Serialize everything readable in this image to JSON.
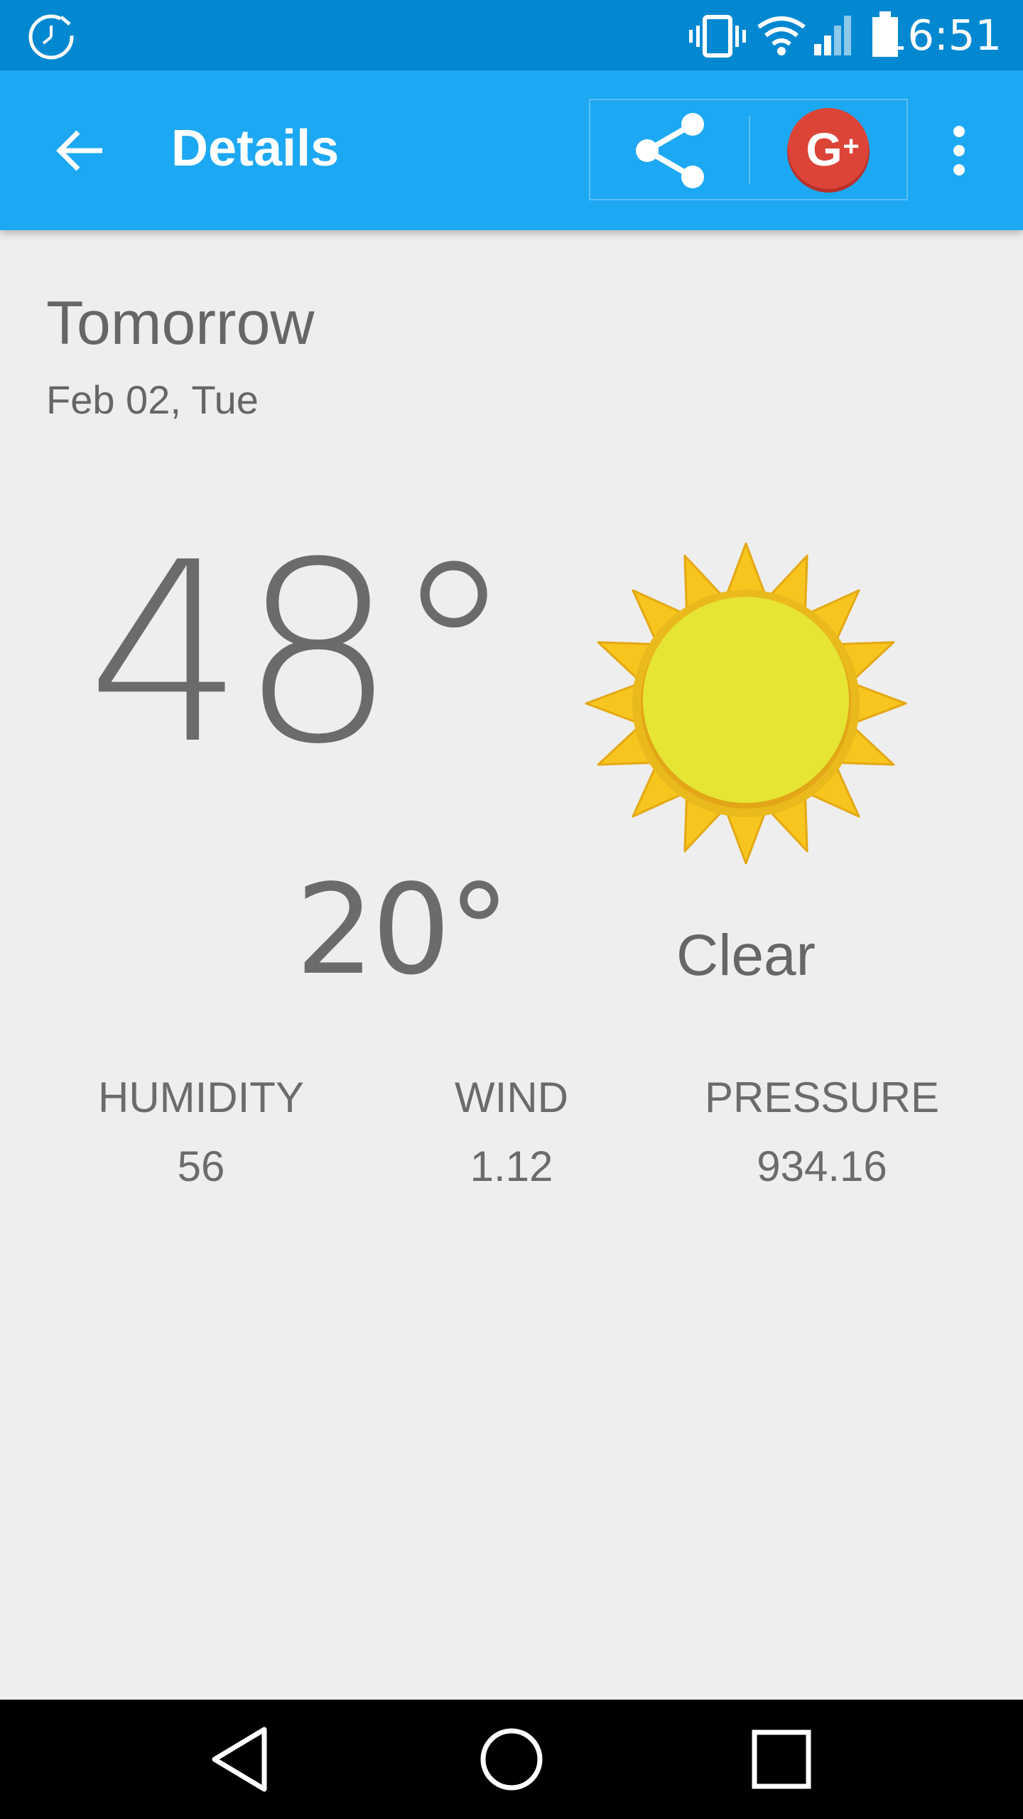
{
  "status_bar": {
    "time": "16:51",
    "icons": [
      "alarm-clock-icon",
      "vibrate-icon",
      "wifi-icon",
      "cellular-signal-icon",
      "battery-icon"
    ]
  },
  "app_bar": {
    "title": "Details",
    "icons": [
      "back-arrow-icon",
      "share-icon",
      "google-plus-icon",
      "overflow-menu-icon"
    ],
    "color": "#1da8f3",
    "dark_color": "#0288d1"
  },
  "forecast": {
    "day": "Tomorrow",
    "date": "Feb 02, Tue",
    "high": "48°",
    "low": "20°",
    "condition": "Clear",
    "icon": "sun-icon"
  },
  "metrics": [
    {
      "label": "HUMIDITY",
      "value": "56"
    },
    {
      "label": "WIND",
      "value": "1.12"
    },
    {
      "label": "PRESSURE",
      "value": "934.16"
    }
  ],
  "nav_bar": {
    "icons": [
      "nav-back-icon",
      "nav-home-icon",
      "nav-recents-icon"
    ]
  }
}
